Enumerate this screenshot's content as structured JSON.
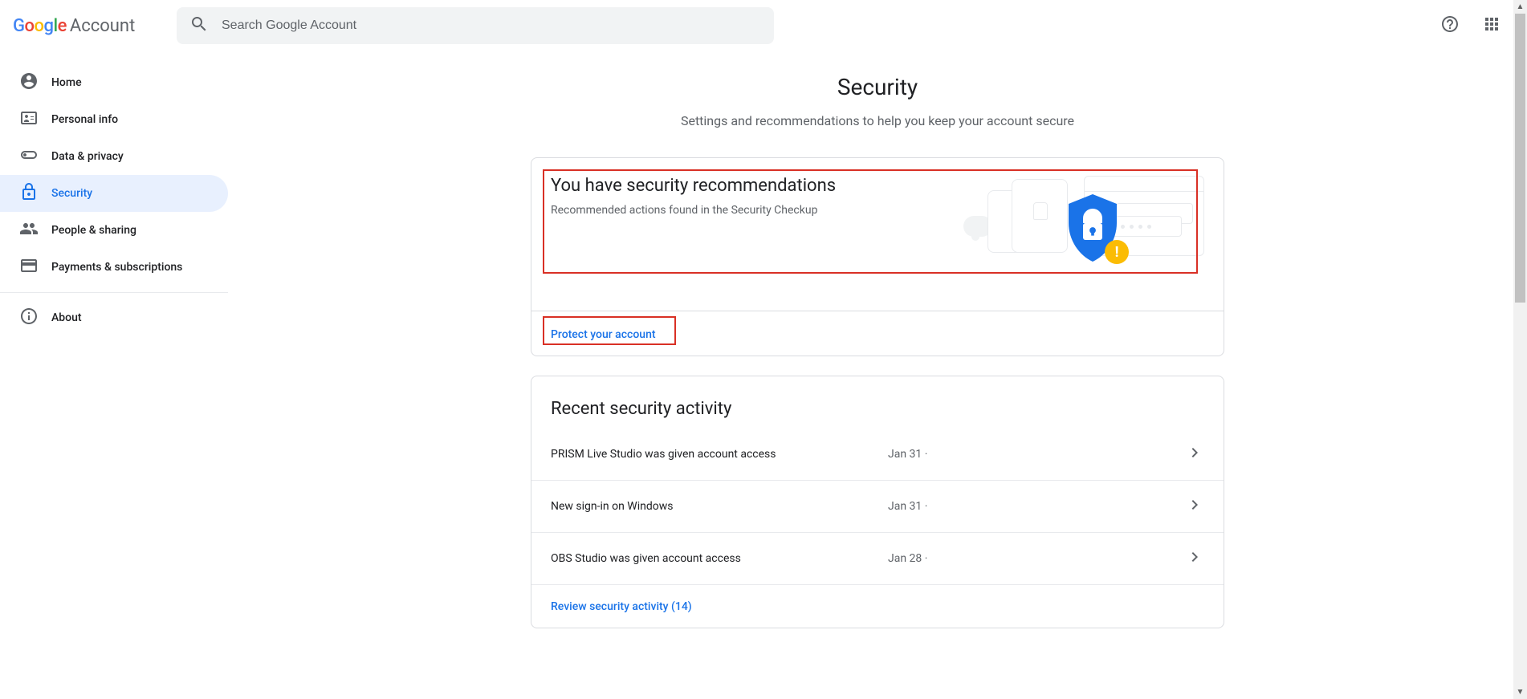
{
  "header": {
    "logo_account": "Account",
    "search_placeholder": "Search Google Account"
  },
  "sidebar": {
    "items": [
      {
        "label": "Home"
      },
      {
        "label": "Personal info"
      },
      {
        "label": "Data & privacy"
      },
      {
        "label": "Security"
      },
      {
        "label": "People & sharing"
      },
      {
        "label": "Payments & subscriptions"
      }
    ],
    "about_label": "About"
  },
  "page": {
    "title": "Security",
    "subtitle": "Settings and recommendations to help you keep your account secure"
  },
  "reco": {
    "title": "You have security recommendations",
    "subtitle": "Recommended actions found in the Security Checkup",
    "cta": "Protect your account"
  },
  "recent": {
    "title": "Recent security activity",
    "items": [
      {
        "text": "PRISM Live Studio was given account access",
        "date": "Jan 31"
      },
      {
        "text": "New sign-in on Windows",
        "date": "Jan 31"
      },
      {
        "text": "OBS Studio was given account access",
        "date": "Jan 28"
      }
    ],
    "review_link": "Review security activity (14)"
  }
}
